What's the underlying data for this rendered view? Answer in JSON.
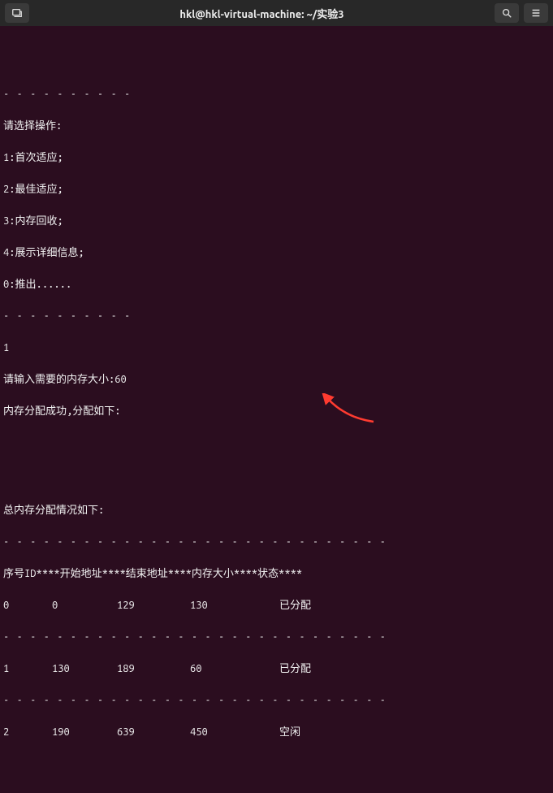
{
  "titlebar": {
    "title": "hkl@hkl-virtual-machine: ~/实验3"
  },
  "term": {
    "sep_top": "- - - - - - - - - -",
    "menu_title": "请选择操作:",
    "menu_items": [
      "1:首次适应;",
      "2:最佳适应;",
      "3:内存回收;",
      "4:展示详细信息;",
      "0:推出......"
    ],
    "sep_mid": "- - - - - - - - - -",
    "user_input": "1",
    "prompt_size": "请输入需要的内存大小:60",
    "success_msg": "内存分配成功,分配如下:",
    "summary_header": "总内存分配情况如下:",
    "long_sep": "- - - - - - - - - - - - - - - - - - - - - - - - - - - - -",
    "table_header": "序号ID****开始地址****结束地址****内存大小****状态****",
    "row_sep": "- - - - - - - - - - - - - - - - - - - - - - - - - - - - -"
  },
  "chart_data": {
    "type": "table",
    "columns": [
      "序号ID",
      "开始地址",
      "结束地址",
      "内存大小",
      "状态"
    ],
    "rows": [
      {
        "id": "0",
        "start": "0",
        "end": "129",
        "size": "130",
        "status": "已分配"
      },
      {
        "id": "1",
        "start": "130",
        "end": "189",
        "size": "60",
        "status": "已分配"
      },
      {
        "id": "2",
        "start": "190",
        "end": "639",
        "size": "450",
        "status": "空闲"
      }
    ]
  }
}
